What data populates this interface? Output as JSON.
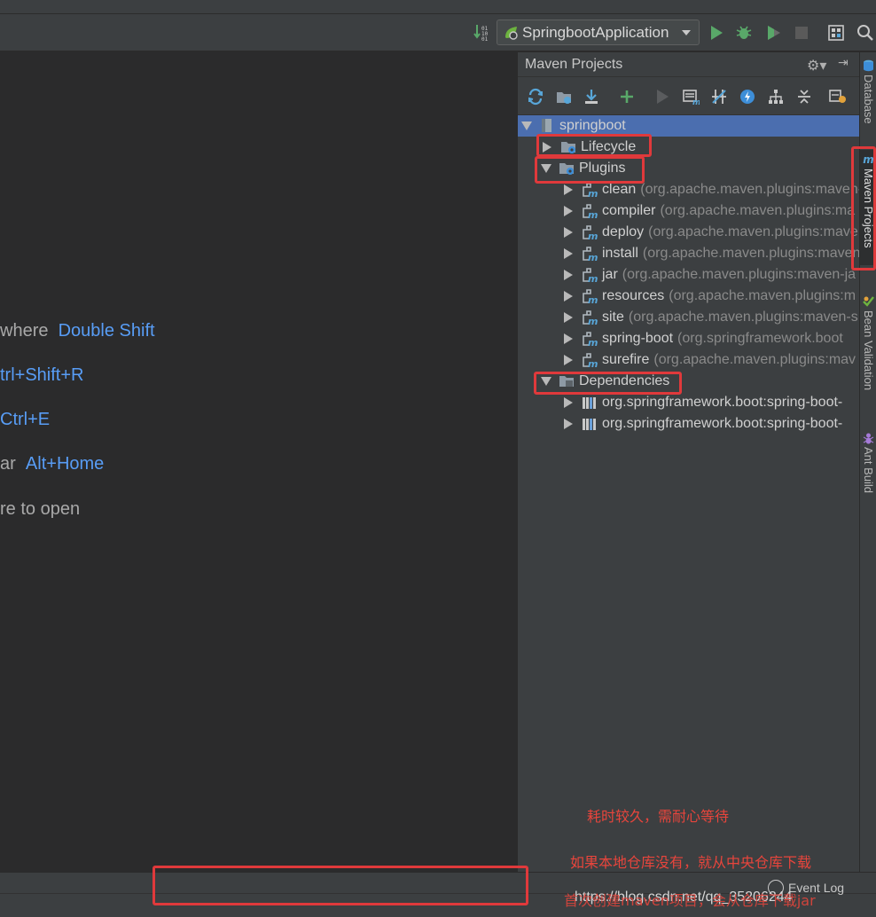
{
  "toolbar": {
    "run_config": "SpringbootApplication"
  },
  "editor": {
    "hints": [
      {
        "text": "where",
        "key": "Double Shift"
      },
      {
        "text": "",
        "key": "trl+Shift+R"
      },
      {
        "text": "",
        "key": "Ctrl+E"
      },
      {
        "text": "ar",
        "key": "Alt+Home"
      },
      {
        "text": "re to open",
        "key": ""
      }
    ]
  },
  "maven": {
    "title": "Maven Projects",
    "root": "springboot",
    "lifecycle": "Lifecycle",
    "plugins": "Plugins",
    "plugin_items": [
      {
        "name": "clean",
        "detail": "(org.apache.maven.plugins:maven-"
      },
      {
        "name": "compiler",
        "detail": "(org.apache.maven.plugins:ma"
      },
      {
        "name": "deploy",
        "detail": "(org.apache.maven.plugins:mave"
      },
      {
        "name": "install",
        "detail": "(org.apache.maven.plugins:maven"
      },
      {
        "name": "jar",
        "detail": "(org.apache.maven.plugins:maven-ja"
      },
      {
        "name": "resources",
        "detail": "(org.apache.maven.plugins:m"
      },
      {
        "name": "site",
        "detail": "(org.apache.maven.plugins:maven-s"
      },
      {
        "name": "spring-boot",
        "detail": "(org.springframework.boot"
      },
      {
        "name": "surefire",
        "detail": "(org.apache.maven.plugins:mav"
      }
    ],
    "dependencies": "Dependencies",
    "dependency_items": [
      "org.springframework.boot:spring-boot-",
      "org.springframework.boot:spring-boot-"
    ]
  },
  "side_tabs": {
    "database": "Database",
    "maven_projects": "Maven Projects",
    "bean_validation": "Bean Validation",
    "ant_build": "Ant Build"
  },
  "annotations": {
    "note1": "耗时较久，需耐心等待",
    "note2": "如果本地仓库没有，就从中央仓库下载",
    "note3": "首次创建maven项目，会从仓库下载jar"
  },
  "status": {
    "event_log": "Event Log",
    "watermark": "https://blog.csdn.net/qq_35206244"
  },
  "colors": {
    "accent": "#589df6",
    "selection": "#4b6eaf",
    "annotation": "#e0393b",
    "run_green": "#59a869"
  }
}
